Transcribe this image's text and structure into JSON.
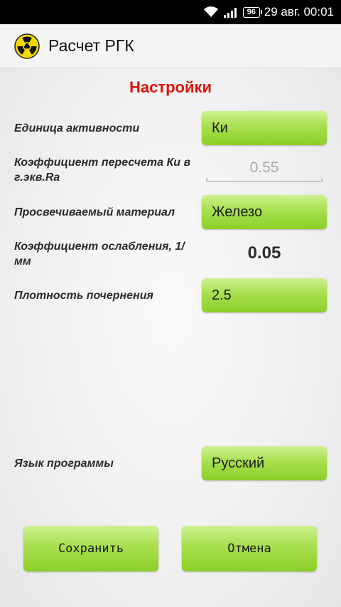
{
  "status_bar": {
    "battery": "96",
    "datetime": "29 авг. 00:01",
    "wifi_icon": "wifi-icon",
    "signal_icon": "signal-icon"
  },
  "app_bar": {
    "icon": "radiation-icon",
    "title": "Расчет РГК"
  },
  "settings": {
    "heading": "Настройки",
    "activity_unit": {
      "label": "Единица активности",
      "value": "Ки"
    },
    "conversion_factor": {
      "label": "Коэффициент пересчета Ки в г.экв.Ra",
      "value": "0.55"
    },
    "material": {
      "label": "Просвечиваемый материал",
      "value": "Железо"
    },
    "attenuation": {
      "label": "Коэффициент ослабления, 1/мм",
      "value": "0.05"
    },
    "density": {
      "label": "Плотность почернения",
      "value": "2.5"
    },
    "language": {
      "label": "Язык программы",
      "value": "Русский"
    }
  },
  "actions": {
    "save": "Сохранить",
    "cancel": "Отмена"
  },
  "colors": {
    "accent_red": "#e0140c",
    "button_green": "#a8df4f"
  }
}
